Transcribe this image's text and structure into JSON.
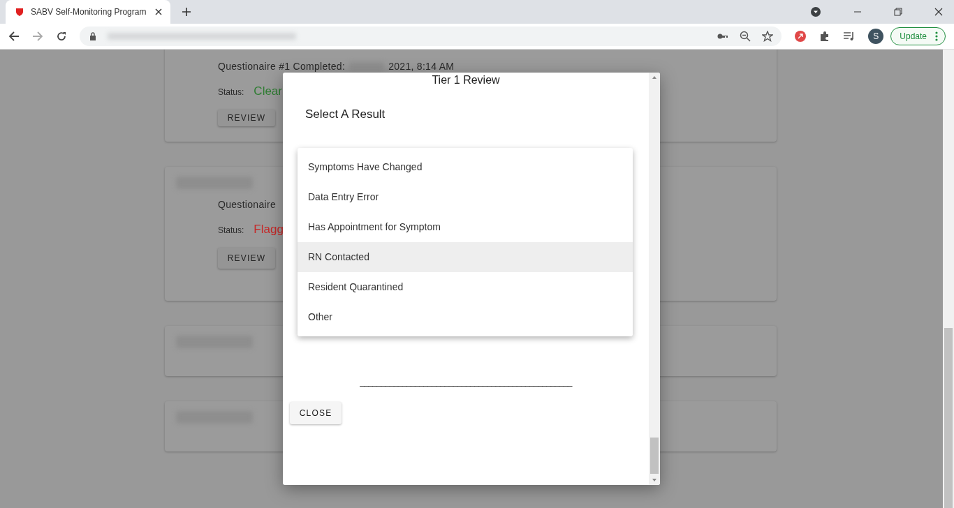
{
  "browser": {
    "tab_title": "SABV Self-Monitoring Program",
    "profile_initial": "S",
    "update_button": "Update"
  },
  "cards": [
    {
      "kind": "result",
      "questionnaire": "Questionaire #1 Completed:",
      "date": "2021, 8:14 AM",
      "status_label": "Status:",
      "status": "Clear",
      "color": "#2e7d32",
      "button": "REVIEW"
    },
    {
      "kind": "result",
      "questionnaire": "Questionaire",
      "status_label": "Status:",
      "status": "Flagg",
      "color": "#c62828",
      "button": "REVIEW"
    },
    {
      "kind": "name"
    },
    {
      "kind": "name"
    }
  ],
  "dialog": {
    "title": "Tier 1 Review",
    "heading": "Select A Result",
    "options": [
      {
        "label": "Symptoms Have Changed",
        "selected": false
      },
      {
        "label": "Data Entry Error",
        "selected": false
      },
      {
        "label": "Has Appointment for Symptom",
        "selected": false
      },
      {
        "label": "RN Contacted",
        "selected": true
      },
      {
        "label": "Resident Quarantined",
        "selected": false
      },
      {
        "label": "Other",
        "selected": false
      }
    ],
    "rule_text": "__________________________________________________",
    "close_button": "CLOSE"
  }
}
